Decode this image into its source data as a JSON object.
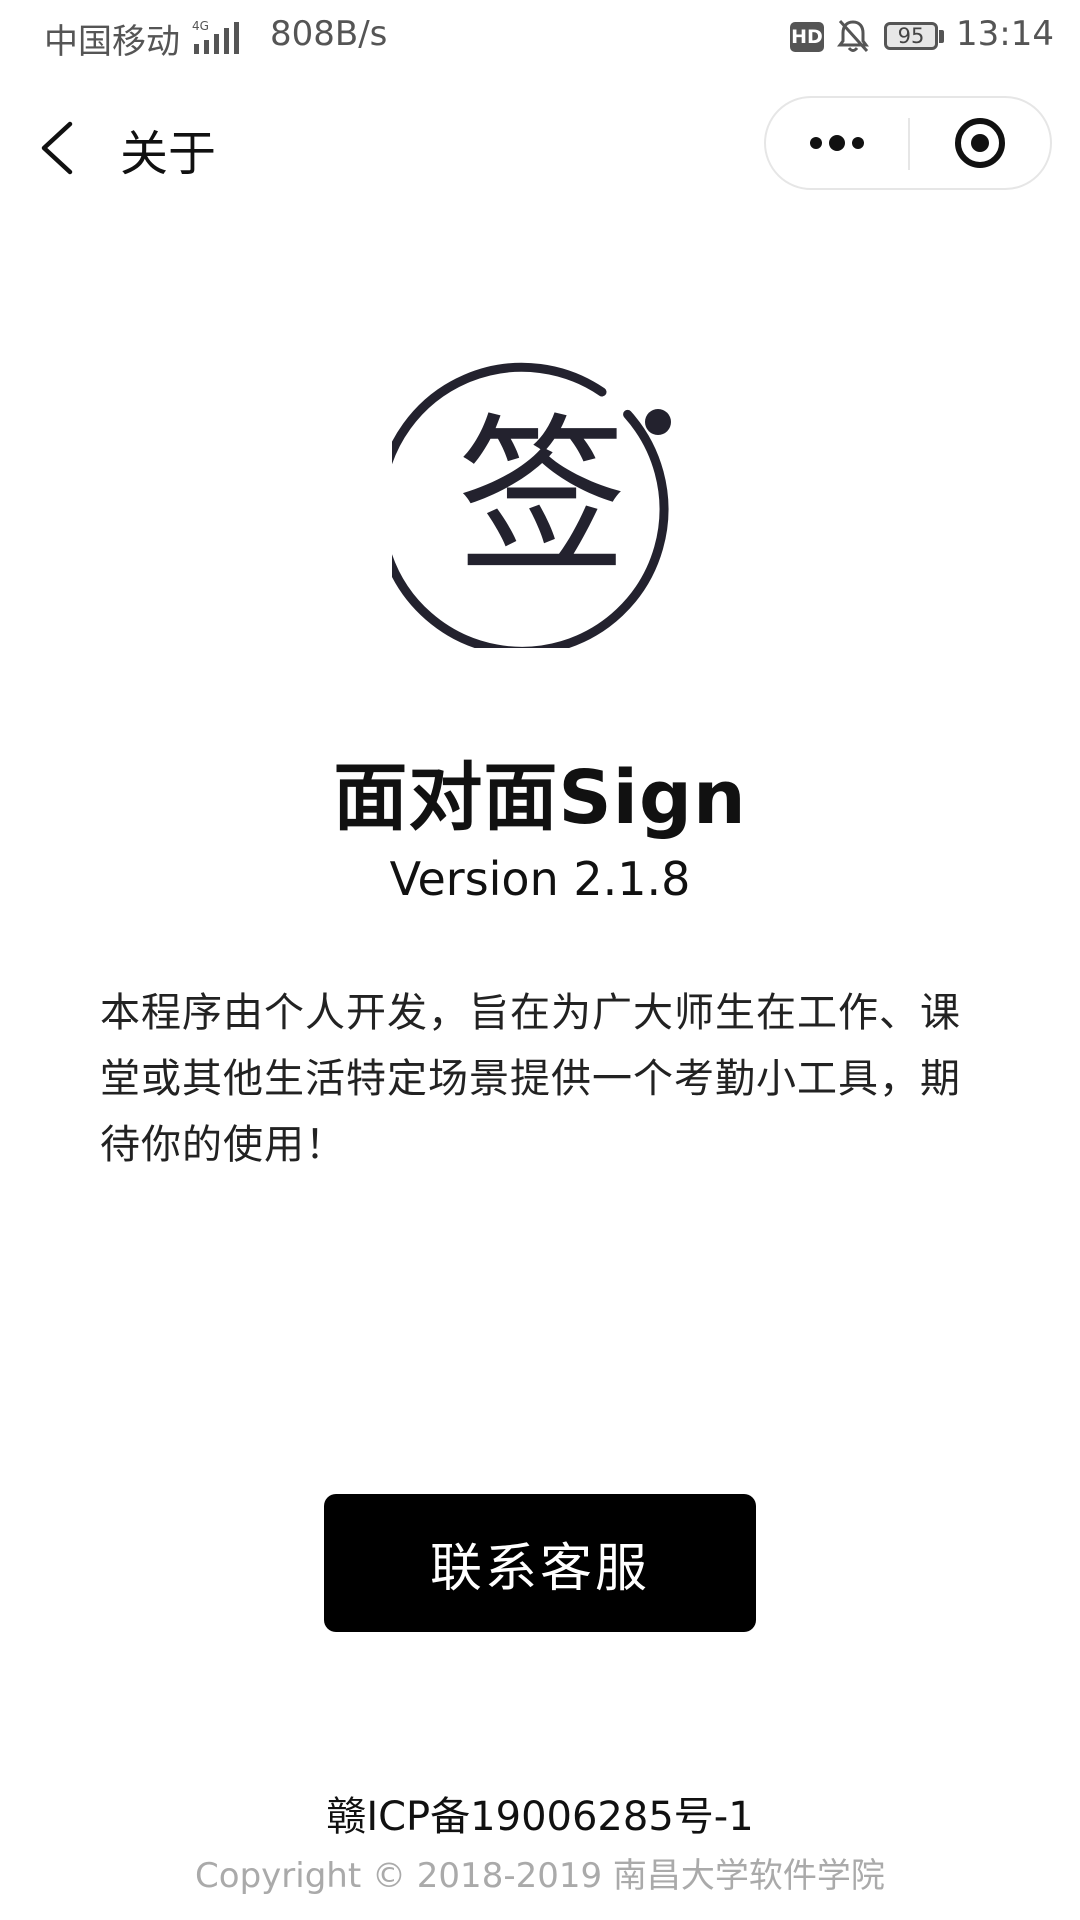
{
  "status_bar": {
    "carrier": "中国移动",
    "signal_icon": "signal-4g-icon",
    "network_speed": "808B/s",
    "hd_badge": "HD",
    "mute_icon": "bell-off-icon",
    "battery_level": "95",
    "time": "13:14"
  },
  "nav": {
    "back_icon": "chevron-left-icon",
    "title": "关于",
    "more_icon": "more-dots-icon",
    "close_icon": "target-close-icon"
  },
  "app": {
    "logo_char": "签",
    "logo_icon": "sign-logo-icon",
    "name": "面对面Sign",
    "version": "Version 2.1.8",
    "description": "本程序由个人开发，旨在为广大师生在工作、课堂或其他生活特定场景提供一个考勤小工具，期待你的使用！"
  },
  "actions": {
    "contact_label": "联系客服"
  },
  "footer": {
    "icp": "赣ICP备19006285号-1",
    "copyright": "Copyright © 2018-2019 南昌大学软件学院"
  },
  "colors": {
    "logo_stroke": "#23222e",
    "button_bg": "#000000",
    "copyright_text": "#aaaaaa"
  }
}
